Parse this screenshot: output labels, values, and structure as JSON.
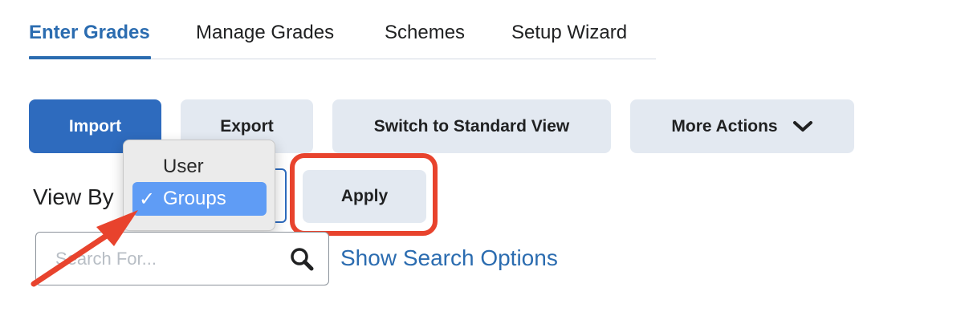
{
  "tabs": [
    {
      "label": "Enter Grades",
      "active": true
    },
    {
      "label": "Manage Grades"
    },
    {
      "label": "Schemes"
    },
    {
      "label": "Setup Wizard"
    }
  ],
  "actions": {
    "import": "Import",
    "export": "Export",
    "switch_view": "Switch to Standard View",
    "more_actions": "More Actions",
    "more_icon": "chevron-down-icon"
  },
  "view_by": {
    "label": "View By",
    "options": [
      "User",
      "Groups"
    ],
    "selected": "Groups",
    "checkmark": "✓",
    "apply": "Apply"
  },
  "search": {
    "placeholder": "Search For...",
    "value": "",
    "icon": "search-icon",
    "show_options": "Show Search Options"
  },
  "colors": {
    "accent": "#2b6cb0",
    "primary_button": "#2e6bbe",
    "secondary_button": "#e3e9f1",
    "selected_option": "#5f9cf5",
    "annotation": "#e8432d"
  }
}
